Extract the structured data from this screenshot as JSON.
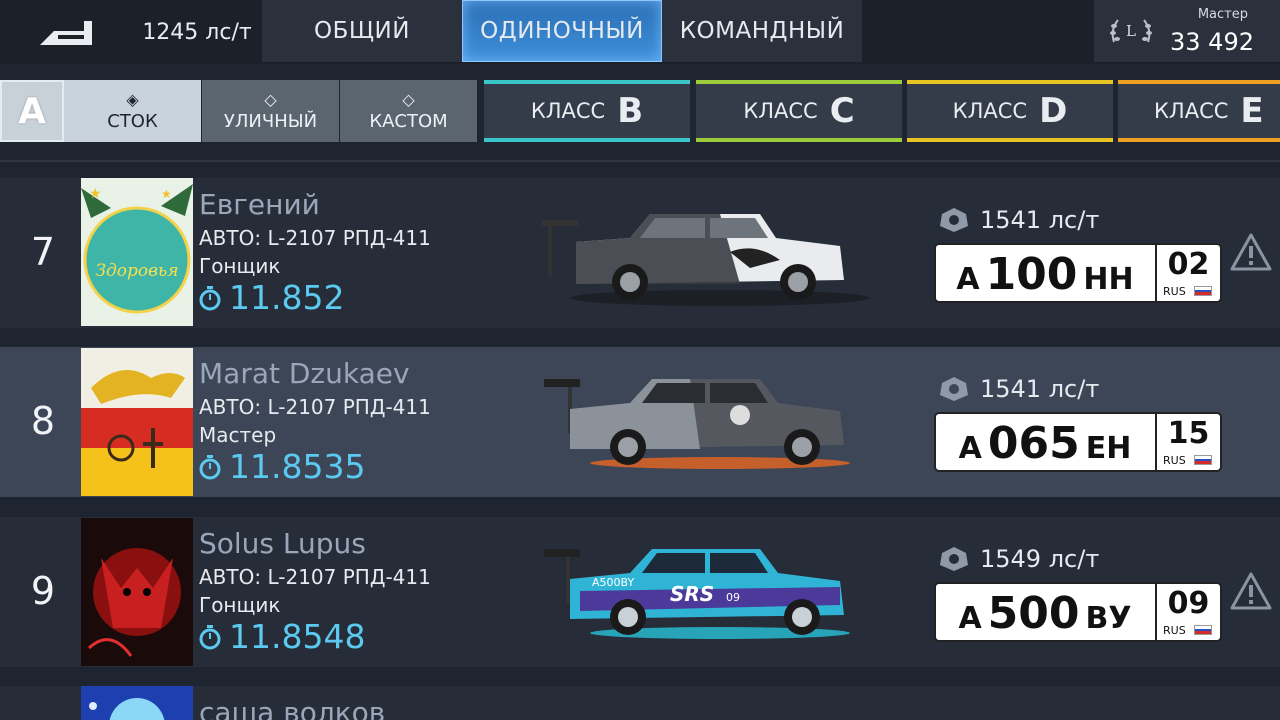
{
  "header": {
    "hp_total": "1245 лс/т",
    "tabs": [
      {
        "label": "ОБЩИЙ",
        "active": false
      },
      {
        "label": "ОДИНОЧНЫЙ",
        "active": true
      },
      {
        "label": "КОМАНДНЫЙ",
        "active": false
      }
    ],
    "rank_title": "Мастер",
    "rank_points": "33 492",
    "laurel_letter": "L"
  },
  "filters": {
    "class_selected": "A",
    "sub_tabs": [
      {
        "label": "СТОК",
        "active": true
      },
      {
        "label": "УЛИЧНЫЙ",
        "active": false
      },
      {
        "label": "КАСТОМ",
        "active": false
      }
    ],
    "classes": [
      {
        "label": "КЛАСС",
        "letter": "B",
        "color": "#39c6c9"
      },
      {
        "label": "КЛАСС",
        "letter": "C",
        "color": "#9ccc3c"
      },
      {
        "label": "КЛАСС",
        "letter": "D",
        "color": "#e8c522"
      },
      {
        "label": "КЛАСС",
        "letter": "E",
        "color": "#f0a020"
      }
    ]
  },
  "rows": [
    {
      "rank": "7",
      "name": "Евгений",
      "car": "АВТО: L-2107 РПД-411",
      "title": "Гонщик",
      "time": "11.852",
      "hp": "1541 лс/т",
      "plate": {
        "l1": "А",
        "num": "100",
        "l2": "НН",
        "region": "02",
        "country": "RUS"
      },
      "avatar_text": "Здоровья",
      "highlight": false
    },
    {
      "rank": "8",
      "name": "Marat Dzukaev",
      "car": "АВТО: L-2107 РПД-411",
      "title": "Мастер",
      "time": "11.8535",
      "hp": "1541 лс/т",
      "plate": {
        "l1": "А",
        "num": "065",
        "l2": "ЕН",
        "region": "15",
        "country": "RUS"
      },
      "highlight": true
    },
    {
      "rank": "9",
      "name": "Solus Lupus",
      "car": "АВТО: L-2107 РПД-411",
      "title": "Гонщик",
      "time": "11.8548",
      "hp": "1549 лс/т",
      "plate": {
        "l1": "А",
        "num": "500",
        "l2": "ВУ",
        "region": "09",
        "country": "RUS"
      },
      "car_decal": "SRS",
      "car_plate_decal": "A500BY",
      "car_decal_num": "09",
      "highlight": false
    },
    {
      "rank": "",
      "name": "саша волков",
      "partial": true
    }
  ],
  "colors": {
    "time": "#5cc9f0",
    "name": "#9aa7ba",
    "active_tab": "#3d8fd9"
  }
}
